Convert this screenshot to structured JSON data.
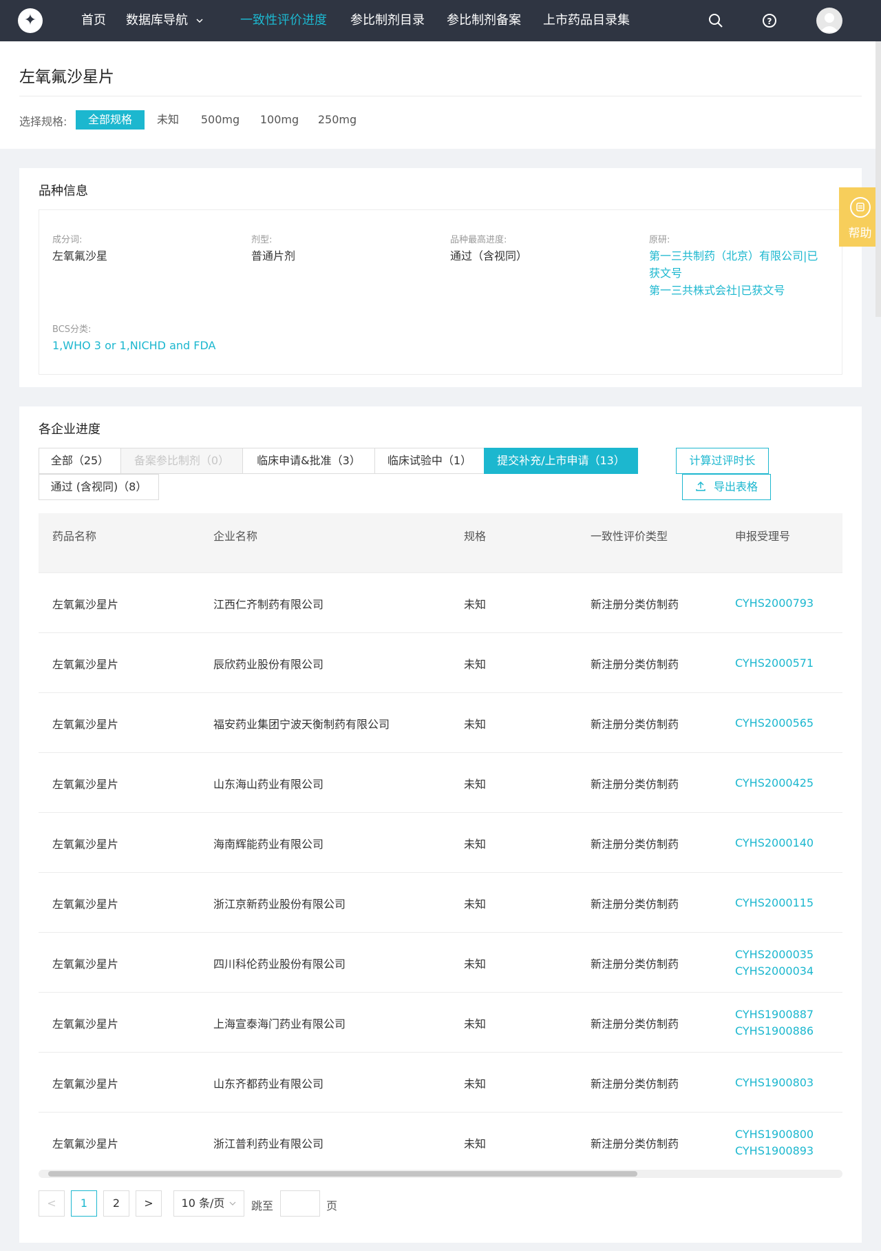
{
  "nav": {
    "items": [
      "首页",
      "数据库导航",
      "一致性评价进度",
      "参比制剂目录",
      "参比制剂备案",
      "上市药品目录集"
    ]
  },
  "page": {
    "title": "左氧氟沙星片",
    "spec_label": "选择规格:",
    "specs": [
      "全部规格",
      "未知",
      "500mg",
      "100mg",
      "250mg"
    ]
  },
  "variety": {
    "title": "品种信息",
    "ingredient_label": "成分词:",
    "ingredient": "左氧氟沙星",
    "dosage_label": "剂型:",
    "dosage": "普通片剂",
    "progress_label": "品种最高进度:",
    "progress": "通过（含视同）",
    "original_label": "原研:",
    "original_1a": "第一三共制药（北京）有限公司|已",
    "original_1b": "获文号",
    "original_2": "第一三共株式会社|已获文号",
    "bcs_label": "BCS分类:",
    "bcs": "1,WHO 3 or 1,NICHD and FDA"
  },
  "progress": {
    "title": "各企业进度",
    "tabs": [
      "全部（25）",
      "备案参比制剂（0）",
      "临床申请&批准（3）",
      "临床试验中（1）",
      "提交补充/上市申请（13）",
      "通过 (含视同)（8）"
    ],
    "calc_button": "计算过评时长",
    "export_button": "导出表格",
    "columns": [
      "药品名称",
      "企业名称",
      "规格",
      "一致性评价类型",
      "申报受理号"
    ],
    "rows": [
      {
        "drug": "左氧氟沙星片",
        "company": "江西仁齐制药有限公司",
        "spec": "未知",
        "type": "新注册分类仿制药",
        "code1": "CYHS2000793",
        "code2": ""
      },
      {
        "drug": "左氧氟沙星片",
        "company": "辰欣药业股份有限公司",
        "spec": "未知",
        "type": "新注册分类仿制药",
        "code1": "CYHS2000571",
        "code2": ""
      },
      {
        "drug": "左氧氟沙星片",
        "company": "福安药业集团宁波天衡制药有限公司",
        "spec": "未知",
        "type": "新注册分类仿制药",
        "code1": "CYHS2000565",
        "code2": ""
      },
      {
        "drug": "左氧氟沙星片",
        "company": "山东海山药业有限公司",
        "spec": "未知",
        "type": "新注册分类仿制药",
        "code1": "CYHS2000425",
        "code2": ""
      },
      {
        "drug": "左氧氟沙星片",
        "company": "海南辉能药业有限公司",
        "spec": "未知",
        "type": "新注册分类仿制药",
        "code1": "CYHS2000140",
        "code2": ""
      },
      {
        "drug": "左氧氟沙星片",
        "company": "浙江京新药业股份有限公司",
        "spec": "未知",
        "type": "新注册分类仿制药",
        "code1": "CYHS2000115",
        "code2": ""
      },
      {
        "drug": "左氧氟沙星片",
        "company": "四川科伦药业股份有限公司",
        "spec": "未知",
        "type": "新注册分类仿制药",
        "code1": "CYHS2000035",
        "code2": "CYHS2000034"
      },
      {
        "drug": "左氧氟沙星片",
        "company": "上海宣泰海门药业有限公司",
        "spec": "未知",
        "type": "新注册分类仿制药",
        "code1": "CYHS1900887",
        "code2": "CYHS1900886"
      },
      {
        "drug": "左氧氟沙星片",
        "company": "山东齐都药业有限公司",
        "spec": "未知",
        "type": "新注册分类仿制药",
        "code1": "CYHS1900803",
        "code2": ""
      },
      {
        "drug": "左氧氟沙星片",
        "company": "浙江普利药业有限公司",
        "spec": "未知",
        "type": "新注册分类仿制药",
        "code1": "CYHS1900800",
        "code2": "CYHS1900893"
      }
    ]
  },
  "pagination": {
    "prev": "<",
    "pages": [
      "1",
      "2"
    ],
    "next": ">",
    "page_size": "10 条/页",
    "jump_label": "跳至",
    "page_unit": "页"
  },
  "help": {
    "label": "帮助"
  },
  "colors": {
    "accent": "#1cb7cf",
    "nav_bg": "#2f3542",
    "help_bg": "#f7ce5b"
  }
}
